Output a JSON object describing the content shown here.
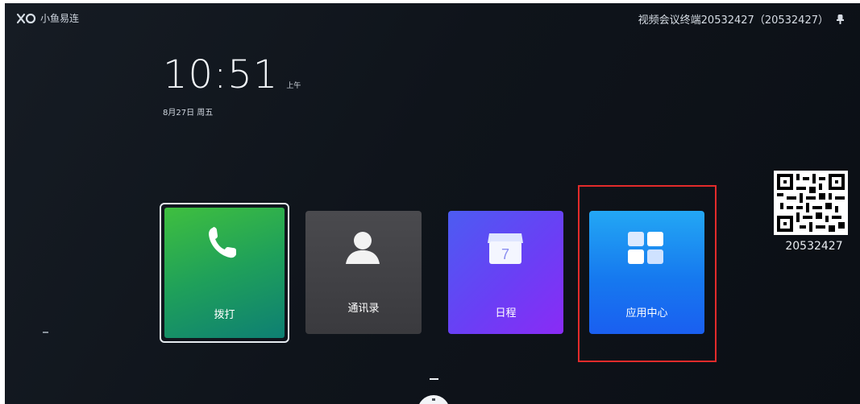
{
  "brand": {
    "name": "小鱼易连",
    "logo_icon": "xylink-logo-icon"
  },
  "status_bar": {
    "device_label": "视频会议终端20532427（20532427）",
    "mic_icon": "microphone-icon"
  },
  "clock": {
    "time": "10:51",
    "ampm": "上午",
    "date": "8月27日 周五"
  },
  "tiles": [
    {
      "label": "拨打",
      "icon": "phone-icon",
      "color": "#2fae4d"
    },
    {
      "label": "通讯录",
      "icon": "contact-person-icon",
      "color": "#3f3f43"
    },
    {
      "label": "日程",
      "icon": "calendar-icon",
      "color": "#6a3ff5"
    },
    {
      "label": "应用中心",
      "icon": "app-grid-icon",
      "color": "#1679ef"
    }
  ],
  "highlight_color": "#e32b2b",
  "qr": {
    "icon": "qr-code-icon",
    "number": "20532427"
  }
}
